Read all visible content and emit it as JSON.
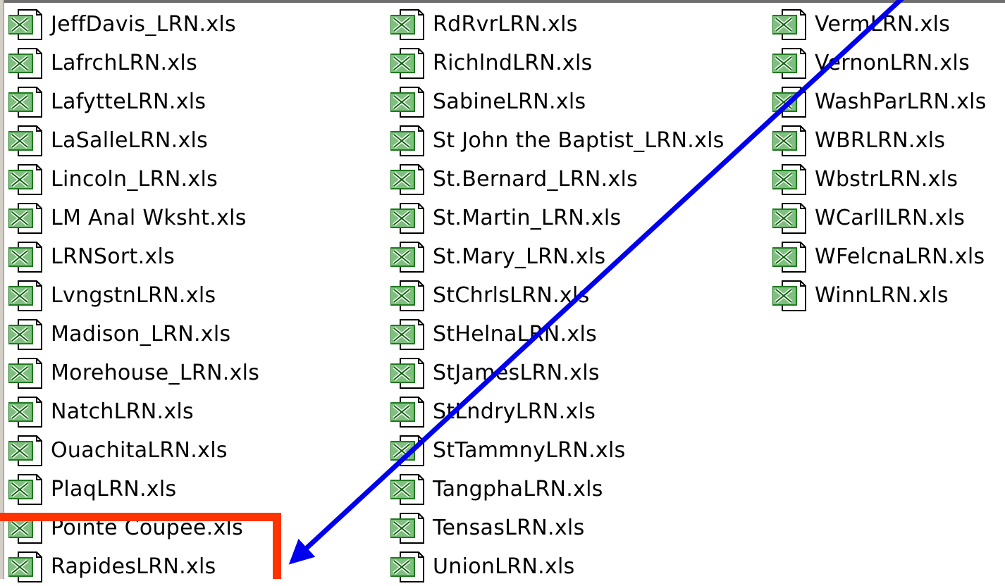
{
  "columns": [
    [
      "JeffDavis_LRN.xls",
      "LafrchLRN.xls",
      "LafytteLRN.xls",
      "LaSalleLRN.xls",
      "Lincoln_LRN.xls",
      "LM Anal Wksht.xls",
      "LRNSort.xls",
      "LvngstnLRN.xls",
      "Madison_LRN.xls",
      "Morehouse_LRN.xls",
      "NatchLRN.xls",
      "OuachitaLRN.xls",
      "PlaqLRN.xls",
      "Pointe Coupee.xls",
      "RapidesLRN.xls"
    ],
    [
      "RdRvrLRN.xls",
      "RichlndLRN.xls",
      "SabineLRN.xls",
      "St John the Baptist_LRN.xls",
      "St.Bernard_LRN.xls",
      "St.Martin_LRN.xls",
      "St.Mary_LRN.xls",
      "StChrlsLRN.xls",
      "StHelnaLRN.xls",
      "StJamesLRN.xls",
      "StLndryLRN.xls",
      "StTammnyLRN.xls",
      "TangphaLRN.xls",
      "TensasLRN.xls",
      "UnionLRN.xls"
    ],
    [
      "VermLRN.xls",
      "VernonLRN.xls",
      "WashParLRN.xls",
      "WBRLRN.xls",
      "WbstrLRN.xls",
      "WCarllLRN.xls",
      "WFelcnaLRN.xls",
      "WinnLRN.xls"
    ]
  ],
  "file_icon": "excel-file-icon",
  "annotation_colors": {
    "arrow": "#0000ee",
    "highlight_box": "#ff3300"
  }
}
